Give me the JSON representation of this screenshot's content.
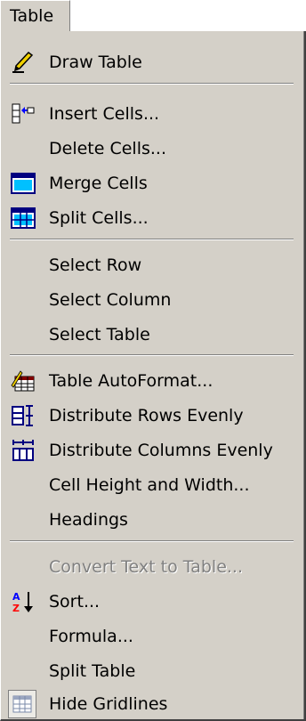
{
  "menubar": {
    "title": "Table"
  },
  "menu": {
    "draw_table": "Draw Table",
    "insert_cells": "Insert Cells...",
    "delete_cells": "Delete Cells...",
    "merge_cells": "Merge Cells",
    "split_cells": "Split Cells...",
    "select_row": "Select Row",
    "select_column": "Select Column",
    "select_table": "Select Table",
    "table_autoformat": "Table AutoFormat...",
    "distribute_rows": "Distribute Rows Evenly",
    "distribute_columns": "Distribute Columns Evenly",
    "cell_height_width": "Cell Height and Width...",
    "headings": "Headings",
    "convert_text": "Convert Text to Table...",
    "sort": "Sort...",
    "formula": "Formula...",
    "split_table": "Split Table",
    "hide_gridlines": "Hide Gridlines"
  },
  "icons": {
    "draw_table": "pencil-icon",
    "insert_cells": "insert-cells-icon",
    "merge_cells": "merge-cells-icon",
    "split_cells": "split-cells-icon",
    "table_autoformat": "table-autoformat-icon",
    "distribute_rows": "distribute-rows-icon",
    "distribute_columns": "distribute-columns-icon",
    "sort": "sort-az-icon",
    "hide_gridlines": "gridlines-icon"
  },
  "colors": {
    "menu_bg": "#d4d0c8",
    "disabled_text": "#808080",
    "icon_blue": "#0000ff",
    "icon_cyan": "#00c0ff"
  }
}
